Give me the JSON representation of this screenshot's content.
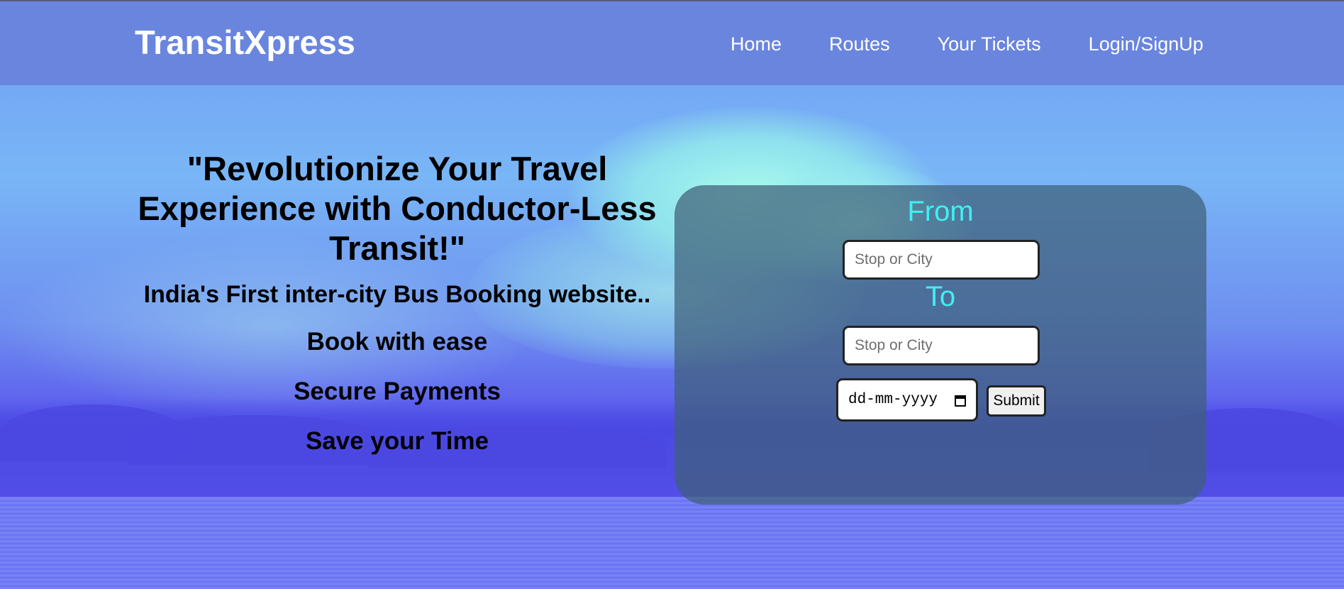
{
  "header": {
    "logo": "TransitXpress",
    "nav": [
      "Home",
      "Routes",
      "Your Tickets",
      "Login/SignUp"
    ]
  },
  "hero": {
    "headline": "\"Revolutionize Your Travel Experience with Conductor-Less Transit!\"",
    "subheadline": "India's First inter-city Bus Booking website..",
    "features": [
      "Book with ease",
      "Secure Payments",
      "Save your Time"
    ]
  },
  "booking": {
    "from_label": "From",
    "from_placeholder": "Stop or City",
    "to_label": "To",
    "to_placeholder": "Stop or City",
    "date_placeholder": "dd-mm-yyyy",
    "submit_label": "Submit"
  },
  "colors": {
    "header_bg": "#6985de",
    "label_accent": "#3ef0f2",
    "panel_bg": "rgba(62,95,120,0.72)"
  }
}
